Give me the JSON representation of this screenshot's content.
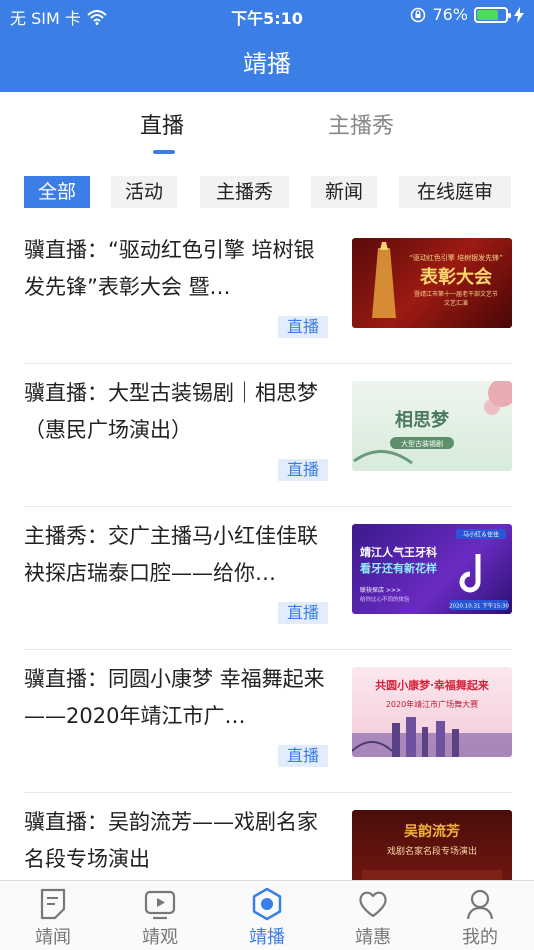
{
  "status_bar": {
    "carrier": "无 SIM 卡",
    "time": "下午5:10",
    "battery_percent": "76%",
    "battery_level": 0.76
  },
  "nav": {
    "title": "靖播"
  },
  "tabs": [
    {
      "label": "直播",
      "active": true
    },
    {
      "label": "主播秀",
      "active": false
    }
  ],
  "filters": [
    {
      "label": "全部",
      "active": true
    },
    {
      "label": "活动",
      "active": false
    },
    {
      "label": "主播秀",
      "active": false
    },
    {
      "label": "新闻",
      "active": false
    },
    {
      "label": "在线庭审",
      "active": false
    }
  ],
  "items": [
    {
      "title": "骥直播：“驱动红色引擎 培树银发先锋”表彰大会 暨…",
      "tag": "直播",
      "thumb": {
        "line1": "“驱动红色引擎 培树银发先锋”",
        "big": "表彰大会",
        "line3": "暨靖江市第十一届老干部文艺节",
        "line4": "文艺汇演"
      }
    },
    {
      "title": "骥直播：大型古装锡剧｜相思梦（惠民广场演出）",
      "tag": "直播",
      "thumb": {
        "big": "相思梦",
        "sub": "大型古装锡剧"
      }
    },
    {
      "title": "主播秀：交广主播马小红佳佳联袂探店瑞泰口腔——给你…",
      "tag": "直播",
      "thumb": {
        "badge": "马小红＆佳佳",
        "line1": "靖江人气王牙科",
        "line2": "看牙还有新花样",
        "line3": "联袂探店 >>>",
        "line4": "给你比心不同的体验",
        "date": "2020.10.31 下午15:30"
      }
    },
    {
      "title": "骥直播：同圆小康梦 幸福舞起来——2020年靖江市广…",
      "tag": "直播",
      "thumb": {
        "big": "共圆小康梦·幸福舞起来",
        "sub": "2020年靖江市广场舞大赛"
      }
    },
    {
      "title": "骥直播：吴韵流芳——戏剧名家名段专场演出",
      "tag": "",
      "thumb": {
        "big": "吴韵流芳",
        "sub": "戏剧名家名段专场演出"
      }
    }
  ],
  "tabbar": [
    {
      "label": "靖闻",
      "icon": "document-icon",
      "active": false
    },
    {
      "label": "靖观",
      "icon": "play-screen-icon",
      "active": false
    },
    {
      "label": "靖播",
      "icon": "hexagon-icon",
      "active": true
    },
    {
      "label": "靖惠",
      "icon": "heart-icon",
      "active": false
    },
    {
      "label": "我的",
      "icon": "user-icon",
      "active": false
    }
  ],
  "colors": {
    "primary": "#3a7ee6",
    "tag_bg": "#e3ecfb"
  }
}
